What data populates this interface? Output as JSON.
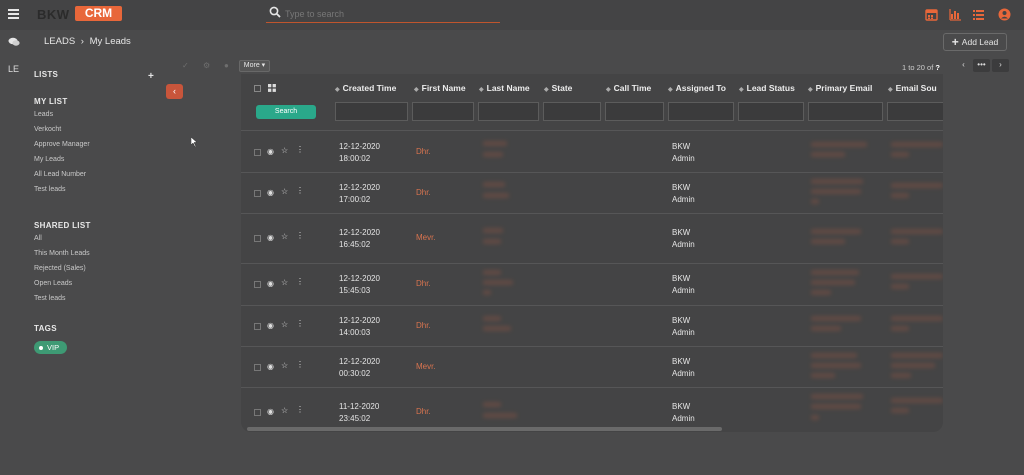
{
  "app": {
    "logo_left": "BKW",
    "logo_right": "CRM"
  },
  "search": {
    "placeholder": "Type to search"
  },
  "sidebar_stub": {
    "le": "LE"
  },
  "breadcrumb": {
    "root": "LEADS",
    "separator": "›",
    "current": "My Leads"
  },
  "actions": {
    "add_lead": "Add Lead",
    "more": "More ▾",
    "search_btn": "Search"
  },
  "pagination": {
    "range": "1 to 20",
    "of": "of",
    "total": "?"
  },
  "sidebar": {
    "lists_heading": "LISTS",
    "my_list_heading": "MY LIST",
    "my_list": [
      "Leads",
      "Verkocht",
      "Approve Manager",
      "My Leads",
      "All Lead Number",
      "Test leads"
    ],
    "shared_heading": "SHARED LIST",
    "shared_list": [
      "All",
      "This Month Leads",
      "Rejected (Sales)",
      "Open Leads",
      "Test leads"
    ],
    "tags_heading": "TAGS",
    "tag": "VIP"
  },
  "table": {
    "columns": [
      "Created Time",
      "First Name",
      "Last Name",
      "State",
      "Call Time",
      "Assigned To",
      "Lead Status",
      "Primary Email",
      "Email Sou"
    ],
    "rows": [
      {
        "date": "12-12-2020",
        "time": "18:00:02",
        "first_name": "Dhr.",
        "assigned_1": "BKW",
        "assigned_2": "Admin"
      },
      {
        "date": "12-12-2020",
        "time": "17:00:02",
        "first_name": "Dhr.",
        "assigned_1": "BKW",
        "assigned_2": "Admin"
      },
      {
        "date": "12-12-2020",
        "time": "16:45:02",
        "first_name": "Mevr.",
        "assigned_1": "BKW",
        "assigned_2": "Admin"
      },
      {
        "date": "12-12-2020",
        "time": "15:45:03",
        "first_name": "Dhr.",
        "assigned_1": "BKW",
        "assigned_2": "Admin"
      },
      {
        "date": "12-12-2020",
        "time": "14:00:03",
        "first_name": "Dhr.",
        "assigned_1": "BKW",
        "assigned_2": "Admin"
      },
      {
        "date": "12-12-2020",
        "time": "00:30:02",
        "first_name": "Mevr.",
        "assigned_1": "BKW",
        "assigned_2": "Admin"
      },
      {
        "date": "11-12-2020",
        "time": "23:45:02",
        "first_name": "Dhr.",
        "assigned_1": "BKW",
        "assigned_2": "Admin"
      }
    ]
  },
  "colors": {
    "accent": "#e8673a",
    "search_green": "#2aa88a",
    "tag_green": "#3e9a74",
    "name_orange": "#d9744f"
  }
}
